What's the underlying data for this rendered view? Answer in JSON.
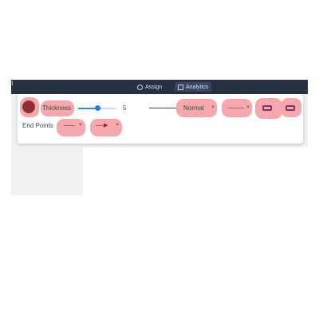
{
  "topbar": {
    "edge_text": "d",
    "assign_label": "Assign",
    "assign_icon": "user-circle-icon",
    "analytics_label": "Analytics",
    "analytics_icon": "chart-square-icon"
  },
  "toolbar": {
    "color_swatch": "#8f2f31",
    "thickness_label": "Thickness",
    "thickness_value": "5",
    "thickness_level_pct": 44,
    "slider_color": "#3b82e6",
    "line_style_label": "Normal",
    "end_points_label": "End Points",
    "highlight_color": "#f4a3a8",
    "icons": {
      "dropdown": "chevron-down-icon",
      "start_arrow": "arrow-start-icon",
      "end_arrow": "arrow-end-icon",
      "end_arrow_preview": "arrow-right-icon"
    }
  }
}
